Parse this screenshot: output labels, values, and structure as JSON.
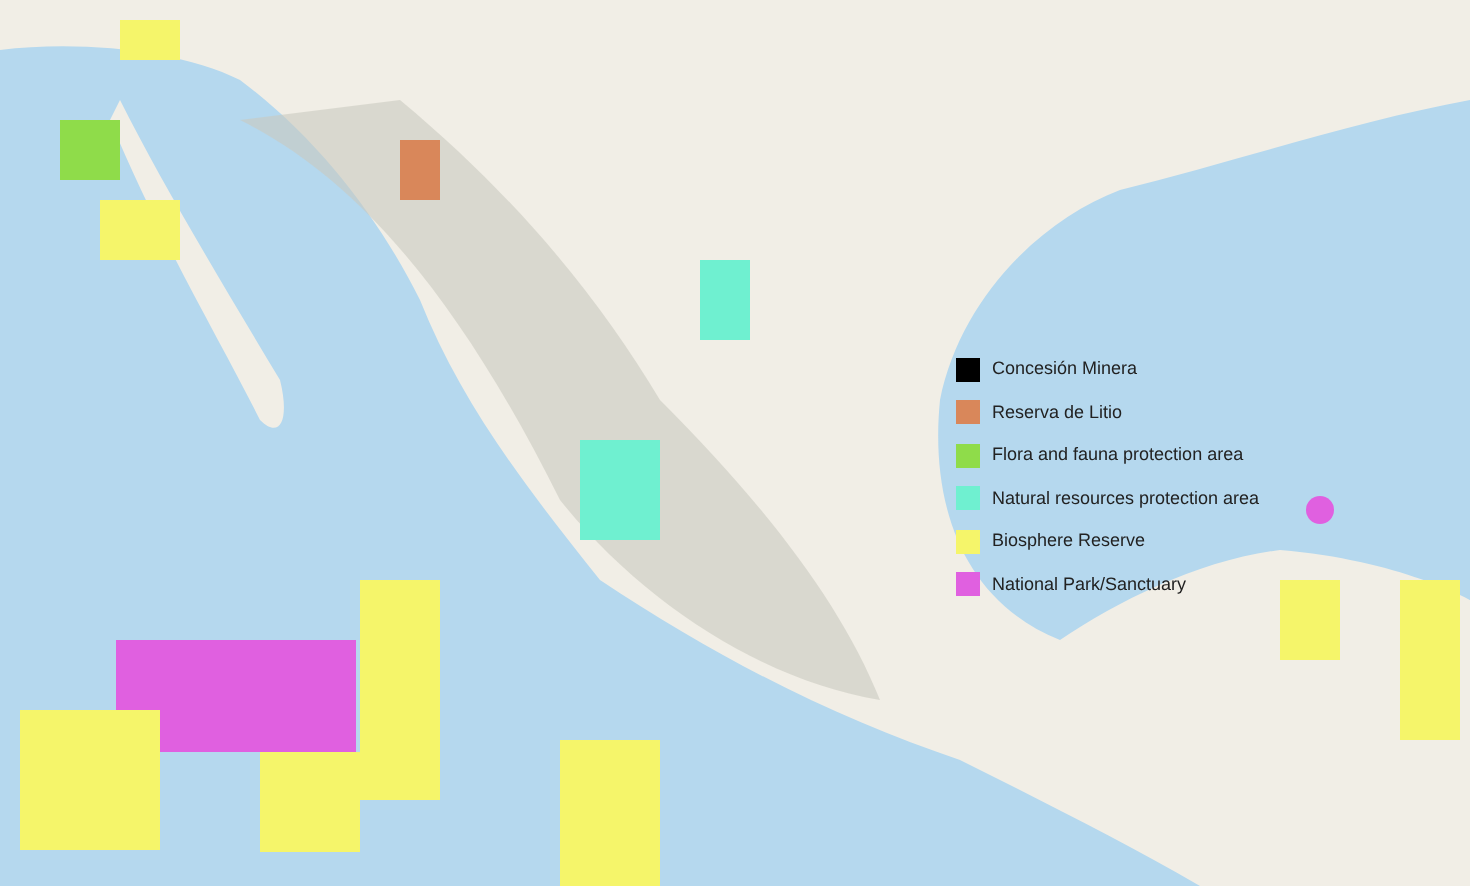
{
  "legend": {
    "items": [
      {
        "label": "Concesión Minera",
        "color": "#000000"
      },
      {
        "label": "Reserva de Litio",
        "color": "#d9875a"
      },
      {
        "label": "Flora and fauna protection area",
        "color": "#8fdc4a"
      },
      {
        "label": "Natural resources protection area",
        "color": "#6ff0d0"
      },
      {
        "label": "Biosphere Reserve",
        "color": "#f5f56a"
      },
      {
        "label": "National Park/Sanctuary",
        "color": "#e060e0"
      }
    ]
  }
}
